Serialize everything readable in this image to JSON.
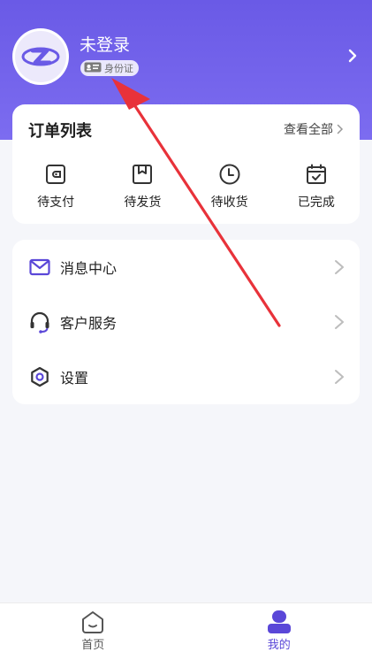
{
  "colors": {
    "header_gradient_top": "#6a5ae6",
    "header_gradient_bottom": "#7c6cf0",
    "accent": "#5a47d8",
    "arrow_annotation": "#e8323a"
  },
  "profile": {
    "username": "未登录",
    "badge_label": "身份证",
    "avatar_icon": "app-logo-icon"
  },
  "orders": {
    "title": "订单列表",
    "view_all": "查看全部",
    "items": [
      {
        "label": "待支付",
        "icon": "wallet-icon"
      },
      {
        "label": "待发货",
        "icon": "box-icon"
      },
      {
        "label": "待收货",
        "icon": "clock-icon"
      },
      {
        "label": "已完成",
        "icon": "calendar-check-icon"
      }
    ]
  },
  "menu": {
    "items": [
      {
        "label": "消息中心",
        "icon": "mail-icon"
      },
      {
        "label": "客户服务",
        "icon": "headset-icon"
      },
      {
        "label": "设置",
        "icon": "settings-icon"
      }
    ]
  },
  "tabbar": {
    "tabs": [
      {
        "label": "首页",
        "icon": "home-icon",
        "active": false
      },
      {
        "label": "我的",
        "icon": "user-icon",
        "active": true
      }
    ]
  }
}
